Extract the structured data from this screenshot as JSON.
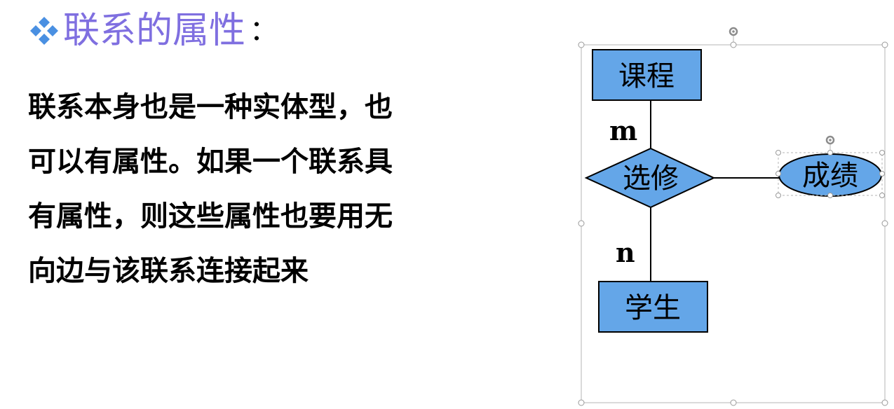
{
  "heading": {
    "text": "联系的属性",
    "colon": "：",
    "bullet_icon": "diamond-cluster-icon",
    "color": "#7f6fe0"
  },
  "body": {
    "lines": [
      "联系本身也是一种实体型，也",
      "可以有属性。如果一个联系具",
      "有属性，则这些属性也要用无",
      "向边与该联系连接起来"
    ]
  },
  "diagram": {
    "entity_top": "课程",
    "relationship": "选修",
    "entity_bottom": "学生",
    "attribute": "成绩",
    "cardinality_top": "m",
    "cardinality_bottom": "n",
    "fill_color": "#64a6e8"
  }
}
